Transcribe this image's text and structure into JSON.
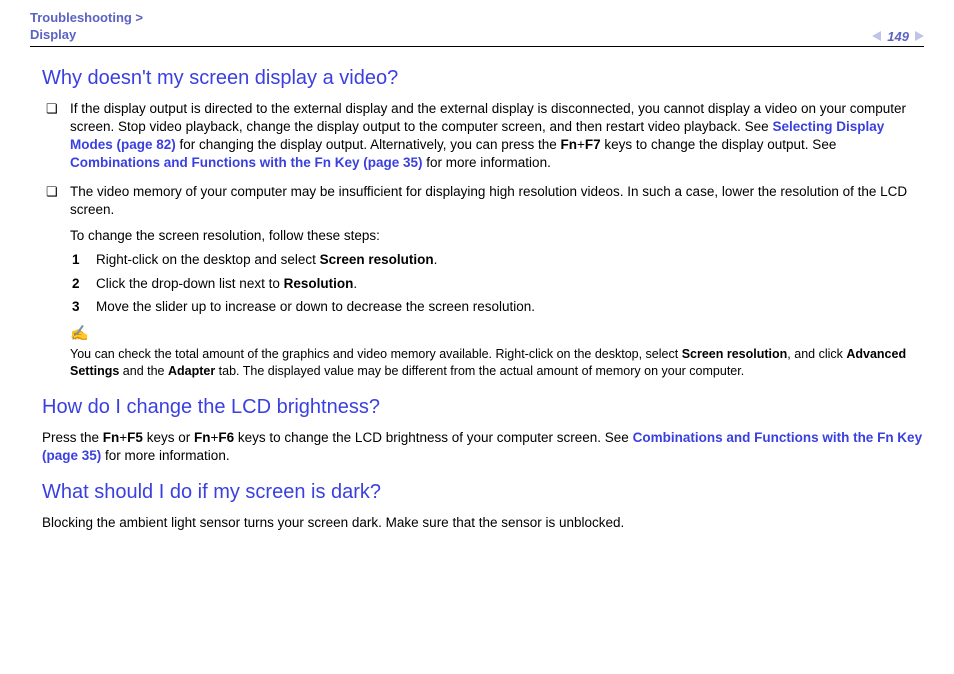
{
  "header": {
    "breadcrumb_line1": "Troubleshooting >",
    "breadcrumb_line2": "Display",
    "page_number": "149"
  },
  "section1": {
    "heading": "Why doesn't my screen display a video?",
    "bullet1_a": "If the display output is directed to the external display and the external display is disconnected, you cannot display a video on your computer screen. Stop video playback, change the display output to the computer screen, and then restart video playback. See ",
    "bullet1_link1": "Selecting Display Modes (page 82)",
    "bullet1_b": " for changing the display output. Alternatively, you can press the ",
    "bullet1_fn": "Fn",
    "bullet1_plus": "+",
    "bullet1_f7": "F7",
    "bullet1_c": " keys to change the display output. See ",
    "bullet1_link2": "Combinations and Functions with the Fn Key (page 35)",
    "bullet1_d": " for more information.",
    "bullet2": "The video memory of your computer may be insufficient for displaying high resolution videos. In such a case, lower the resolution of the LCD screen.",
    "sub_intro": "To change the screen resolution, follow these steps:",
    "step1_a": "Right-click on the desktop and select ",
    "step1_b": "Screen resolution",
    "step1_c": ".",
    "step2_a": "Click the drop-down list next to ",
    "step2_b": "Resolution",
    "step2_c": ".",
    "step3": "Move the slider up to increase or down to decrease the screen resolution.",
    "note_icon": "✍",
    "note_a": "You can check the total amount of the graphics and video memory available. Right-click on the desktop, select ",
    "note_b": "Screen resolution",
    "note_c": ", and click ",
    "note_d": "Advanced Settings",
    "note_e": " and the ",
    "note_f": "Adapter",
    "note_g": " tab. The displayed value may be different from the actual amount of memory on your computer."
  },
  "section2": {
    "heading": "How do I change the LCD brightness?",
    "p_a": "Press the ",
    "p_fn1": "Fn",
    "p_plus1": "+",
    "p_f5": "F5",
    "p_b": " keys or ",
    "p_fn2": "Fn",
    "p_plus2": "+",
    "p_f6": "F6",
    "p_c": " keys to change the LCD brightness of your computer screen. See ",
    "p_link": "Combinations and Functions with the Fn Key (page 35)",
    "p_d": " for more information."
  },
  "section3": {
    "heading": "What should I do if my screen is dark?",
    "p": "Blocking the ambient light sensor turns your screen dark. Make sure that the sensor is unblocked."
  }
}
